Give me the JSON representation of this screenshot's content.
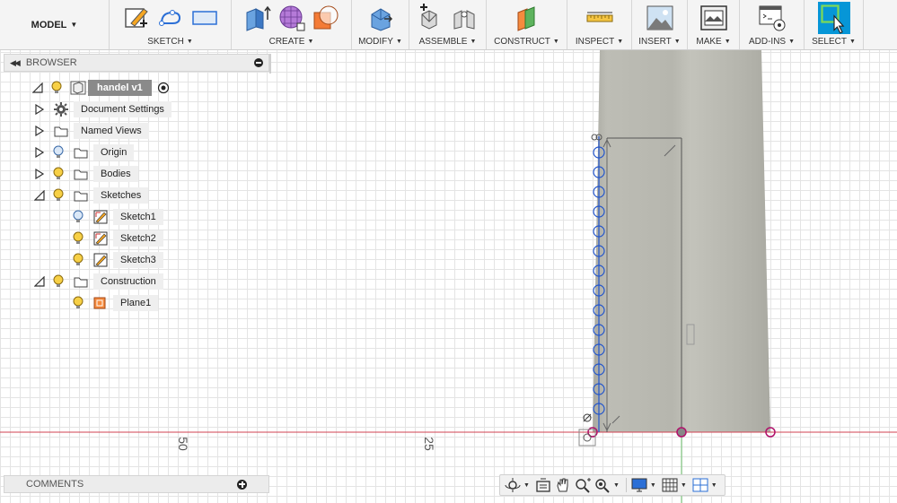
{
  "toolbar": {
    "workspace": "MODEL",
    "groups": [
      {
        "id": "sketch",
        "label": "SKETCH"
      },
      {
        "id": "create",
        "label": "CREATE"
      },
      {
        "id": "modify",
        "label": "MODIFY"
      },
      {
        "id": "assemble",
        "label": "ASSEMBLE"
      },
      {
        "id": "construct",
        "label": "CONSTRUCT"
      },
      {
        "id": "inspect",
        "label": "INSPECT"
      },
      {
        "id": "insert",
        "label": "INSERT"
      },
      {
        "id": "make",
        "label": "MAKE"
      },
      {
        "id": "addins",
        "label": "ADD-INS"
      },
      {
        "id": "select",
        "label": "SELECT"
      }
    ]
  },
  "browser": {
    "title": "BROWSER",
    "root": "handel v1",
    "items": [
      {
        "label": "Document Settings",
        "icon": "gear-icon"
      },
      {
        "label": "Named Views",
        "icon": "folder-icon"
      },
      {
        "label": "Origin",
        "icon": "folder-icon"
      },
      {
        "label": "Bodies",
        "icon": "folder-icon"
      },
      {
        "label": "Sketches",
        "icon": "folder-icon"
      },
      {
        "label": "Sketch1",
        "icon": "sketch-icon"
      },
      {
        "label": "Sketch2",
        "icon": "sketch-icon"
      },
      {
        "label": "Sketch3",
        "icon": "sketch-icon"
      },
      {
        "label": "Construction",
        "icon": "folder-icon"
      },
      {
        "label": "Plane1",
        "icon": "plane-icon"
      }
    ]
  },
  "ruler": {
    "labels": [
      "50",
      "25"
    ]
  },
  "comments": {
    "title": "COMMENTS"
  },
  "colors": {
    "accent": "#0696d7",
    "body_fill": "#b8b8b0",
    "sketch_line": "#2255cc",
    "axis_red": "#d04050",
    "constraint_magenta": "#b0106a"
  }
}
